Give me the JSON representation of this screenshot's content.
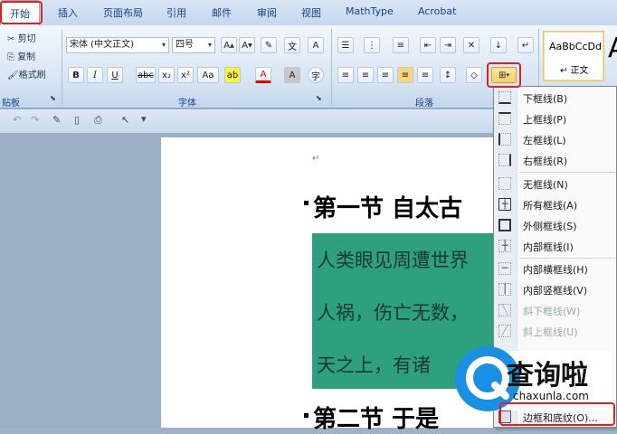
{
  "tabs": [
    {
      "label": "开始"
    },
    {
      "label": "插入"
    },
    {
      "label": "页面布局"
    },
    {
      "label": "引用"
    },
    {
      "label": "邮件"
    },
    {
      "label": "审阅"
    },
    {
      "label": "视图"
    },
    {
      "label": "MathType"
    },
    {
      "label": "Acrobat"
    }
  ],
  "clipboard": {
    "cut": "剪切",
    "copy": "复制",
    "format_painter": "格式刷",
    "title": "贴板"
  },
  "font": {
    "name": "宋体 (中文正文)",
    "size": "四号",
    "title": "字体"
  },
  "paragraph": {
    "title": "段落"
  },
  "styles": {
    "preview": "AaBbCcDd",
    "name": "正文",
    "big_letter": "A"
  },
  "border_menu": {
    "items": [
      {
        "label": "下框线(B)"
      },
      {
        "label": "上框线(P)"
      },
      {
        "label": "左框线(L)"
      },
      {
        "label": "右框线(R)"
      },
      {
        "label": "无框线(N)"
      },
      {
        "label": "所有框线(A)"
      },
      {
        "label": "外侧框线(S)"
      },
      {
        "label": "内部框线(I)"
      },
      {
        "label": "内部横框线(H)"
      },
      {
        "label": "内部竖框线(V)"
      },
      {
        "label": "斜下框线(W)"
      },
      {
        "label": "斜上框线(U)"
      },
      {
        "label": "边框和底纹(O)..."
      }
    ]
  },
  "document": {
    "heading1": "第一节 自太古",
    "lines": [
      "人类眼见周遭世界",
      "人祸，伤亡无数，",
      "天之上，有诸"
    ],
    "heading2": "第二节 于是",
    "para_mark": "↵"
  },
  "watermark": {
    "text": "查询啦",
    "url": "chaxunla.com"
  },
  "colors": {
    "highlight_red": "#e02020",
    "shading_green": "#2fa07e",
    "watermark_blue": "#1a8fe3"
  }
}
